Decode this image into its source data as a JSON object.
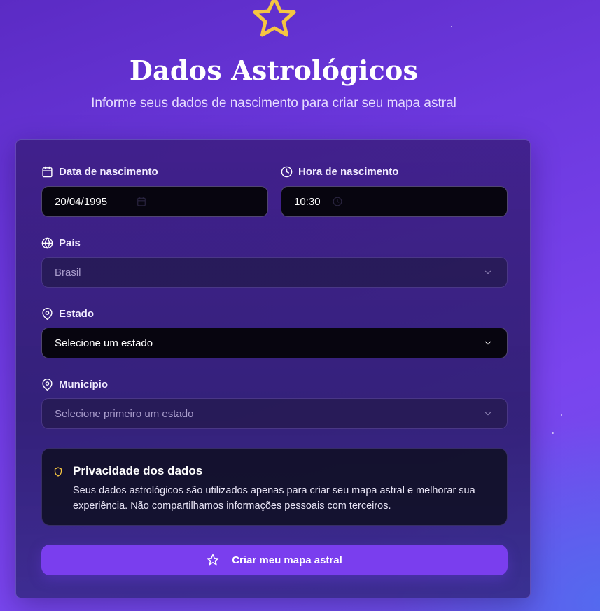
{
  "header": {
    "title": "Dados Astrológicos",
    "subtitle": "Informe seus dados de nascimento para criar seu mapa astral",
    "icon": "star-icon"
  },
  "form": {
    "birth_date": {
      "label": "Data de nascimento",
      "value": "20/04/1995",
      "icon": "calendar-icon"
    },
    "birth_time": {
      "label": "Hora de nascimento",
      "value": "10:30",
      "icon": "clock-icon"
    },
    "country": {
      "label": "País",
      "value": "Brasil",
      "icon": "globe-icon"
    },
    "state": {
      "label": "Estado",
      "value": "Selecione um estado",
      "icon": "map-pin-icon"
    },
    "city": {
      "label": "Município",
      "value": "Selecione primeiro um estado",
      "icon": "map-pin-icon"
    }
  },
  "privacy": {
    "title": "Privacidade dos dados",
    "text": "Seus dados astrológicos são utilizados apenas para criar seu mapa astral e melhorar sua experiência. Não compartilhamos informações pessoais com terceiros.",
    "icon": "shield-icon"
  },
  "submit": {
    "label": "Criar meu mapa astral",
    "icon": "star-icon"
  },
  "colors": {
    "accent": "#7a3eee",
    "star": "#f5c542",
    "background": "#6c38de"
  }
}
